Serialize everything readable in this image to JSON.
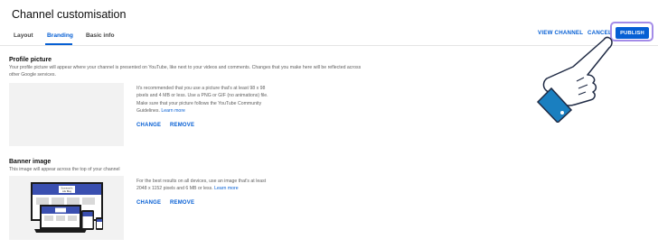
{
  "page": {
    "title": "Channel customisation"
  },
  "tabs": [
    {
      "label": "Layout",
      "active": false
    },
    {
      "label": "Branding",
      "active": true
    },
    {
      "label": "Basic info",
      "active": false
    }
  ],
  "header_actions": {
    "view_channel": "VIEW CHANNEL",
    "cancel": "CANCEL",
    "publish": "PUBLISH"
  },
  "profile_picture": {
    "heading": "Profile picture",
    "description": "Your profile picture will appear where your channel is presented on YouTube, like next to your videos and comments. Changes that you make here will be reflected across other Google services.",
    "info_text": "It's recommended that you use a picture that's at least 98 x 98 pixels and 4 MB or less. Use a PNG or GIF (no animations) file. Make sure that your picture follows the YouTube Community Guidelines.",
    "learn_more": "Learn more",
    "change": "CHANGE",
    "remove": "REMOVE"
  },
  "banner_image": {
    "heading": "Banner image",
    "description": "This image will appear across the top of your channel",
    "info_text": "For the best results on all devices, use an image that's at least 2048 x 1152 pixels and 6 MB or less.",
    "learn_more": "Learn more",
    "change": "CHANGE",
    "remove": "REMOVE",
    "preview_text_line1": "Someone's",
    "preview_text_line2": "Life Blog"
  },
  "colors": {
    "accent": "#065fd4",
    "highlight": "#a48ce8",
    "placeholder": "#f2f2f2"
  }
}
